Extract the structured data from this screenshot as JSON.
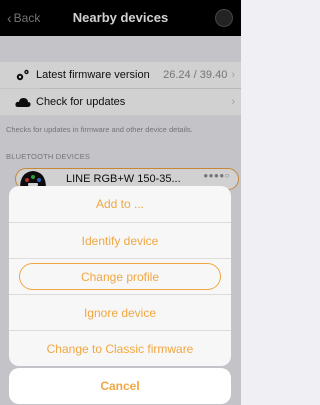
{
  "navbar": {
    "back_label": "Back",
    "title": "Nearby devices",
    "help_icon": "help-icon"
  },
  "rows": {
    "firmware": {
      "label": "Latest firmware version",
      "value": "26.24 / 39.40",
      "icon": "gears-icon"
    },
    "updates": {
      "label": "Check for updates",
      "icon": "cloud-icon"
    }
  },
  "note": "Checks for updates in firmware and other device details.",
  "section_header": "BLUETOOTH DEVICES",
  "device": {
    "name": "LINE RGB+W 150-35...",
    "signal": "●●●●○",
    "icon": "light-fixture-icon"
  },
  "action_sheet": {
    "title": "Add to ...",
    "items": [
      "Identify device",
      "Change profile",
      "Ignore device",
      "Change to Classic firmware"
    ],
    "highlighted_index": 1,
    "cancel_label": "Cancel"
  },
  "colors": {
    "accent": "#f0a742",
    "navbar_bg": "#000000",
    "background": "#efeff4"
  }
}
